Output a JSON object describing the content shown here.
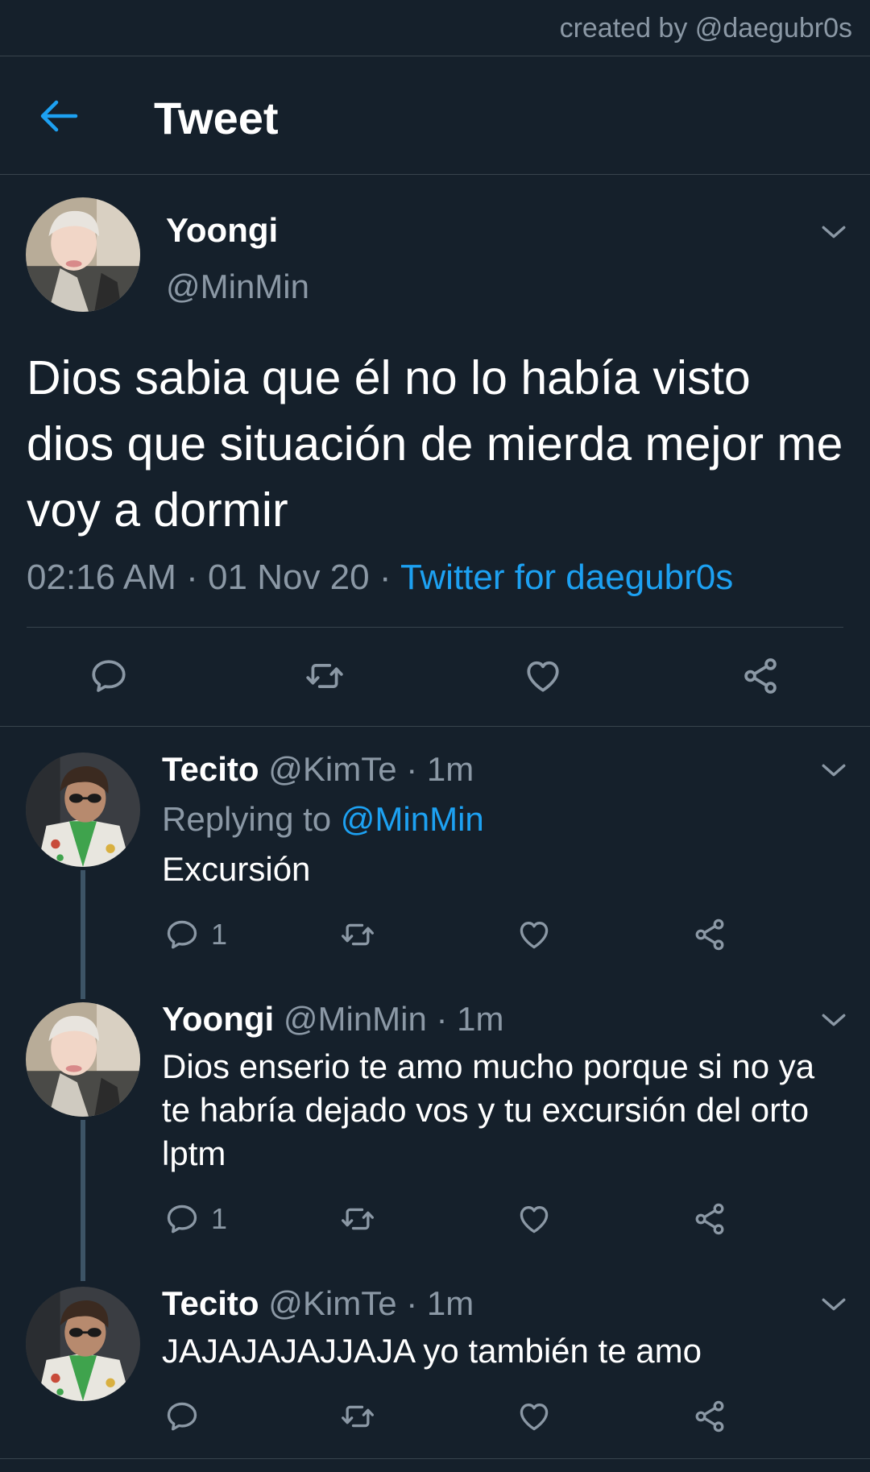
{
  "watermark": "created by @daegubr0s",
  "header": {
    "title": "Tweet"
  },
  "main_tweet": {
    "name": "Yoongi",
    "handle": "@MinMin",
    "text": "Dios sabia que él no lo había visto dios que situación de mierda mejor me voy a dormir",
    "time": "02:16 AM",
    "date": "01 Nov 20",
    "separator": "·",
    "source": "Twitter for daegubr0s"
  },
  "replies": [
    {
      "name": "Tecito",
      "handle": "@KimTe",
      "time": "· 1m",
      "replying_label": "Replying to",
      "replying_to": "@MinMin",
      "text": "Excursión",
      "reply_count": "1"
    },
    {
      "name": "Yoongi",
      "handle": "@MinMin",
      "time": "· 1m",
      "text": "Dios enserio te amo mucho porque si no ya te habría dejado vos y tu excursión del orto lptm",
      "reply_count": "1"
    },
    {
      "name": "Tecito",
      "handle": "@KimTe",
      "time": "· 1m",
      "text": "JAJAJAJAJJAJA yo también te amo",
      "reply_count": ""
    }
  ],
  "colors": {
    "background": "#15202b",
    "accent": "#1da1f2",
    "muted": "#8b98a5",
    "divider": "#38444d"
  },
  "icons": [
    "back-arrow-icon",
    "chevron-down-icon",
    "reply-icon",
    "retweet-icon",
    "like-icon",
    "share-icon"
  ]
}
